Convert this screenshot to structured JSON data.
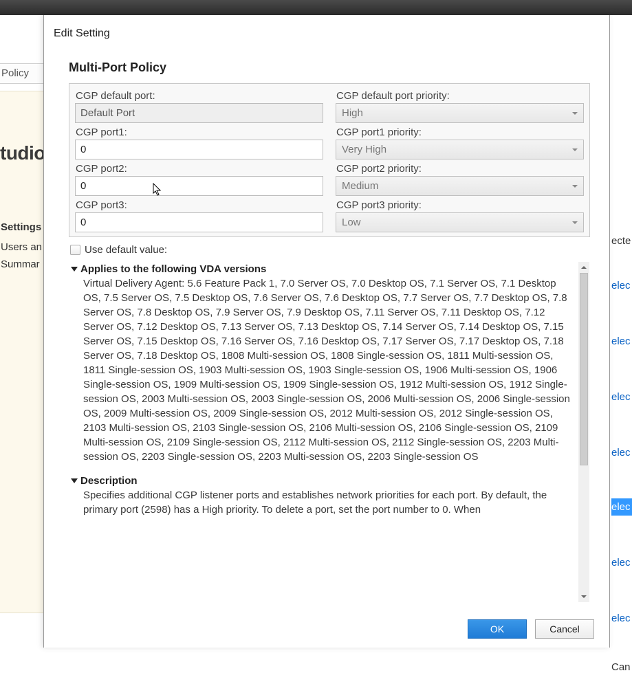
{
  "dialog": {
    "title": "Edit Setting",
    "heading": "Multi-Port Policy",
    "rows": [
      {
        "port_label": "CGP default port:",
        "port_value": "Default Port",
        "port_readonly": true,
        "prio_label": "CGP default port priority:",
        "prio_value": "High"
      },
      {
        "port_label": "CGP port1:",
        "port_value": "0",
        "port_readonly": false,
        "prio_label": "CGP port1 priority:",
        "prio_value": "Very High"
      },
      {
        "port_label": "CGP port2:",
        "port_value": "0",
        "port_readonly": false,
        "prio_label": "CGP port2 priority:",
        "prio_value": "Medium"
      },
      {
        "port_label": "CGP port3:",
        "port_value": "0",
        "port_readonly": false,
        "prio_label": "CGP port3 priority:",
        "prio_value": "Low"
      }
    ],
    "use_default_label": "Use default value:",
    "applies_header": "Applies to the following VDA versions",
    "applies_body": "Virtual Delivery Agent: 5.6 Feature Pack 1, 7.0 Server OS, 7.0 Desktop OS, 7.1 Server OS, 7.1 Desktop OS, 7.5 Server OS, 7.5 Desktop OS, 7.6 Server OS, 7.6 Desktop OS, 7.7 Server OS, 7.7 Desktop OS, 7.8 Server OS, 7.8 Desktop OS, 7.9 Server OS, 7.9 Desktop OS, 7.11 Server OS, 7.11 Desktop OS, 7.12 Server OS, 7.12 Desktop OS, 7.13 Server OS, 7.13 Desktop OS, 7.14 Server OS, 7.14 Desktop OS, 7.15 Server OS, 7.15 Desktop OS, 7.16 Server OS, 7.16 Desktop OS, 7.17 Server OS, 7.17 Desktop OS, 7.18 Server OS, 7.18 Desktop OS, 1808 Multi-session OS, 1808 Single-session OS, 1811 Multi-session OS, 1811 Single-session OS, 1903 Multi-session OS, 1903 Single-session OS, 1906 Multi-session OS, 1906 Single-session OS, 1909 Multi-session OS, 1909 Single-session OS, 1912 Multi-session OS, 1912 Single-session OS, 2003 Multi-session OS, 2003 Single-session OS, 2006 Multi-session OS, 2006 Single-session OS, 2009 Multi-session OS, 2009 Single-session OS, 2012 Multi-session OS, 2012 Single-session OS, 2103 Multi-session OS, 2103 Single-session OS, 2106 Multi-session OS, 2106 Single-session OS, 2109 Multi-session OS, 2109 Single-session OS, 2112 Multi-session OS, 2112 Single-session OS, 2203 Multi-session OS, 2203 Single-session OS, 2203 Multi-session OS, 2203 Single-session OS",
    "description_header": "Description",
    "description_body": "Specifies additional CGP listener ports and establishes network priorities for each port. By default, the primary port (2598) has a High priority. To delete a port, set the port number to 0. When",
    "ok": "OK",
    "cancel": "Cancel"
  },
  "background": {
    "studio": "tudio",
    "tab": "Policy",
    "nav_header": "Settings",
    "nav_users": "Users an",
    "nav_summary": "Summar",
    "right_ecte": "ecte",
    "right_elec": "elec",
    "right_can": "Can"
  }
}
